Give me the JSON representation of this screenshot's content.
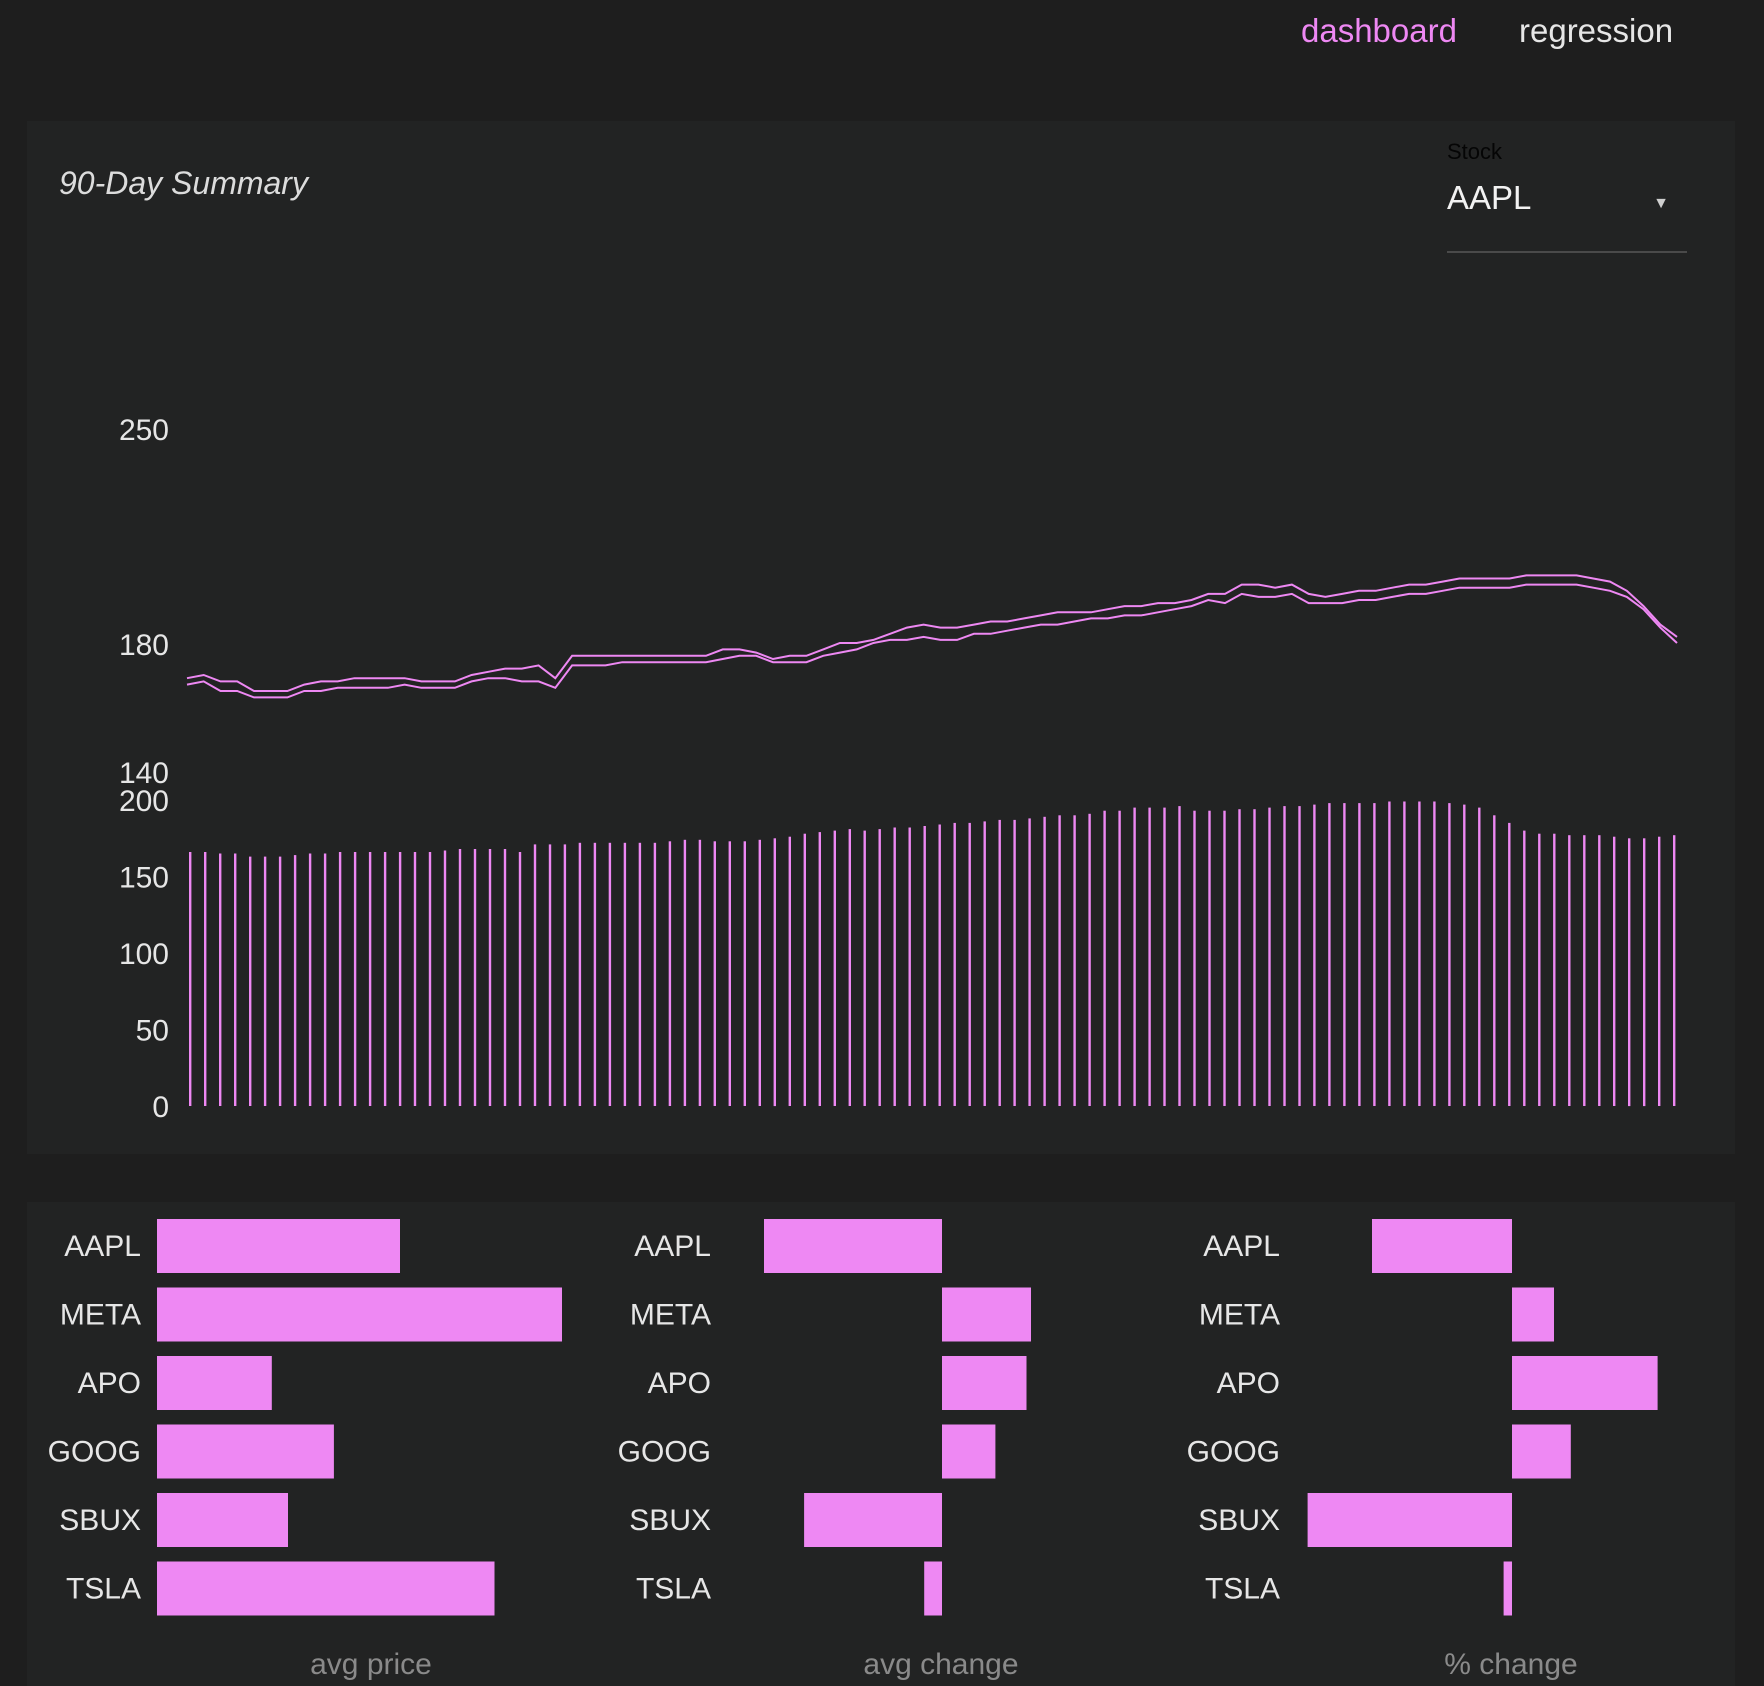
{
  "nav": {
    "items": [
      {
        "label": "dashboard",
        "active": true
      },
      {
        "label": "regression",
        "active": false
      }
    ]
  },
  "summary": {
    "title": "90-Day Summary",
    "stock_select": {
      "label": "Stock",
      "value": "AAPL"
    }
  },
  "colors": {
    "accent": "#ee88f3",
    "background": "#1e1e1e",
    "panel": "#222323",
    "text": "#e6e6e6"
  },
  "chart_data": [
    {
      "type": "line",
      "y_ticks": [
        250,
        180,
        140
      ],
      "ylim": [
        140,
        250
      ],
      "series": [
        {
          "values": [
            169,
            170,
            168,
            168,
            165,
            165,
            165,
            167,
            168,
            168,
            169,
            169,
            169,
            169,
            168,
            168,
            168,
            170,
            171,
            172,
            172,
            173,
            169,
            176,
            176,
            176,
            176,
            176,
            176,
            176,
            176,
            176,
            178,
            178,
            177,
            175,
            176,
            176,
            178,
            180,
            180,
            181,
            183,
            185,
            186,
            185,
            185,
            186,
            187,
            187,
            188,
            189,
            190,
            190,
            190,
            191,
            192,
            192,
            193,
            193,
            194,
            196,
            196,
            199,
            199,
            198,
            199,
            196,
            195,
            196,
            197,
            197,
            198,
            199,
            199,
            200,
            201,
            201,
            201,
            201,
            202,
            202,
            202,
            202,
            201,
            200,
            197,
            192,
            186,
            182
          ]
        },
        {
          "values": [
            167,
            168,
            165,
            165,
            163,
            163,
            163,
            165,
            165,
            166,
            166,
            166,
            166,
            167,
            166,
            166,
            166,
            168,
            169,
            169,
            168,
            168,
            166,
            173,
            173,
            173,
            174,
            174,
            174,
            174,
            174,
            174,
            175,
            176,
            176,
            174,
            174,
            174,
            176,
            177,
            178,
            180,
            181,
            181,
            182,
            181,
            181,
            183,
            183,
            184,
            185,
            186,
            186,
            187,
            188,
            188,
            189,
            189,
            190,
            191,
            192,
            194,
            193,
            196,
            195,
            195,
            196,
            193,
            193,
            193,
            194,
            194,
            195,
            196,
            196,
            197,
            198,
            198,
            198,
            198,
            199,
            199,
            199,
            199,
            198,
            197,
            195,
            191,
            185,
            180
          ]
        }
      ]
    },
    {
      "type": "bar",
      "y_ticks": [
        200,
        150,
        100,
        50,
        0
      ],
      "ylim": [
        0,
        200
      ],
      "values": [
        166,
        166,
        165,
        165,
        163,
        163,
        163,
        164,
        165,
        165,
        166,
        166,
        166,
        166,
        166,
        166,
        166,
        167,
        168,
        168,
        168,
        168,
        166,
        171,
        171,
        171,
        172,
        172,
        172,
        172,
        172,
        172,
        173,
        174,
        174,
        173,
        173,
        173,
        174,
        175,
        176,
        178,
        179,
        180,
        181,
        180,
        181,
        182,
        182,
        183,
        184,
        185,
        185,
        186,
        187,
        187,
        188,
        189,
        190,
        190,
        191,
        193,
        193,
        195,
        195,
        195,
        196,
        193,
        193,
        193,
        194,
        194,
        195,
        196,
        196,
        197,
        198,
        198,
        198,
        198,
        199,
        199,
        199,
        199,
        198,
        197,
        195,
        190,
        185,
        180,
        178,
        178,
        177,
        177,
        177,
        176,
        175,
        175,
        176,
        177
      ]
    },
    {
      "type": "bar",
      "orientation": "horizontal",
      "xlabel": "avg price",
      "categories": [
        "AAPL",
        "META",
        "APO",
        "GOOG",
        "SBUX",
        "TSLA"
      ],
      "values": [
        180,
        300,
        85,
        131,
        97,
        250
      ]
    },
    {
      "type": "bar",
      "orientation": "horizontal",
      "xlabel": "avg change",
      "categories": [
        "AAPL",
        "META",
        "APO",
        "GOOG",
        "SBUX",
        "TSLA"
      ],
      "values": [
        -0.4,
        0.2,
        0.19,
        0.12,
        -0.31,
        -0.04
      ]
    },
    {
      "type": "bar",
      "orientation": "horizontal",
      "xlabel": "% change",
      "categories": [
        "AAPL",
        "META",
        "APO",
        "GOOG",
        "SBUX",
        "TSLA"
      ],
      "values": [
        -0.25,
        0.075,
        0.26,
        0.105,
        -0.365,
        -0.015
      ]
    }
  ]
}
